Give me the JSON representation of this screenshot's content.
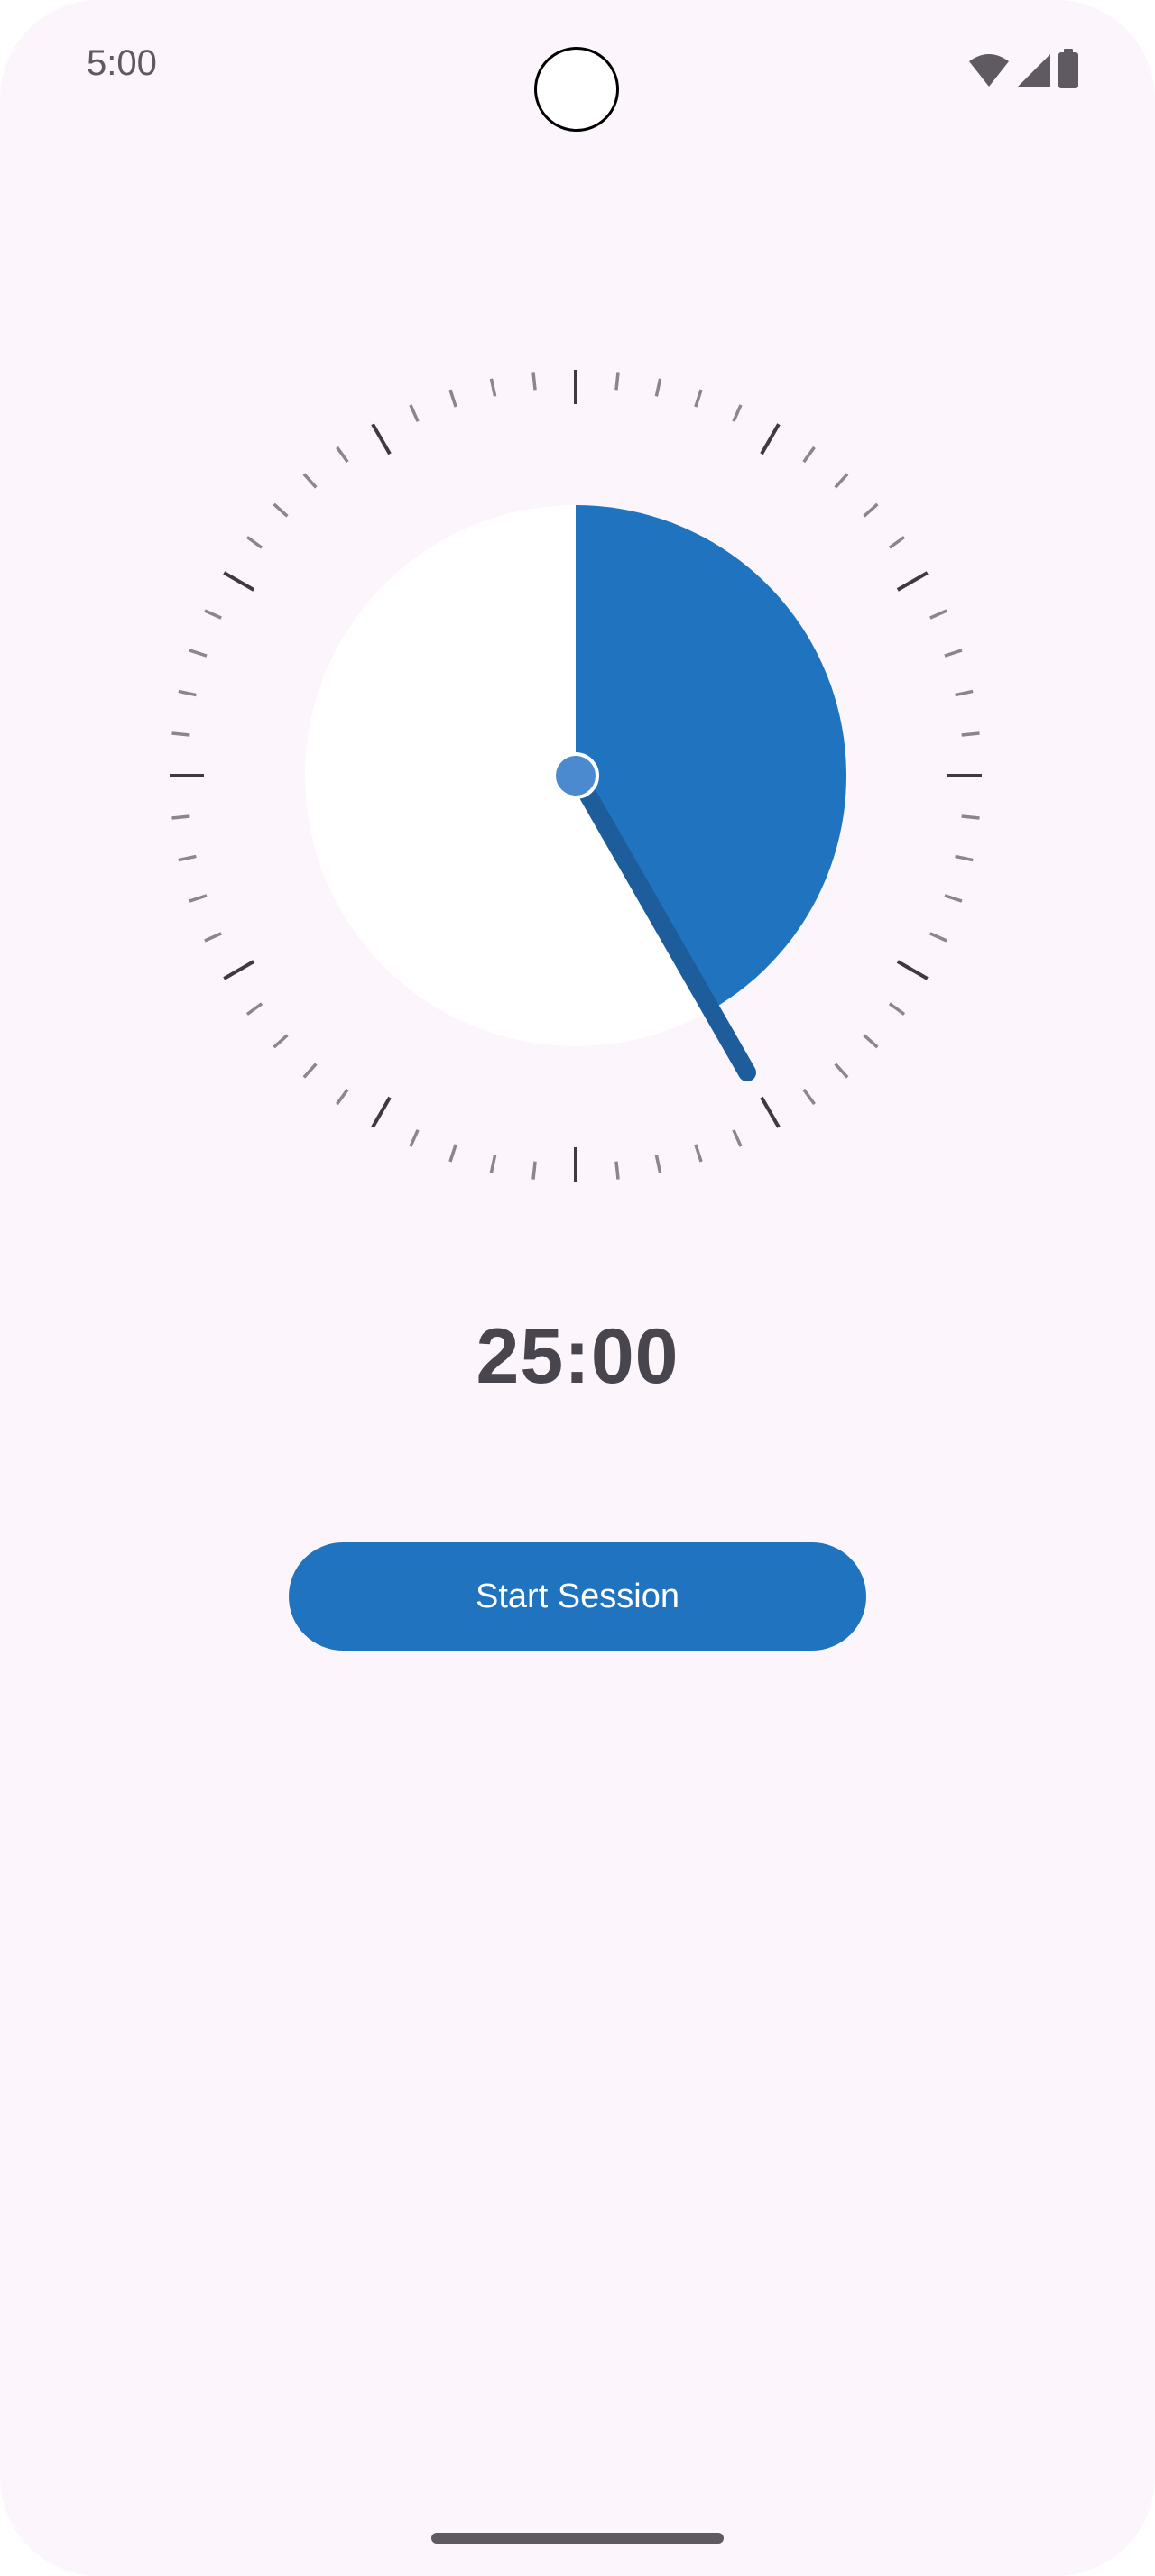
{
  "status_bar": {
    "time": "5:00",
    "icons": [
      "wifi-icon",
      "cellular-signal-icon",
      "battery-icon"
    ]
  },
  "timer": {
    "display": "25:00",
    "total_minutes": 60,
    "set_minutes": 25,
    "progress_fraction": 0.4167
  },
  "actions": {
    "start_label": "Start Session"
  },
  "colors": {
    "background": "#fcf5fc",
    "accent": "#1f73bf",
    "hand": "#1d5d9b",
    "hub": "#4c8ad0",
    "text": "#49454f"
  }
}
